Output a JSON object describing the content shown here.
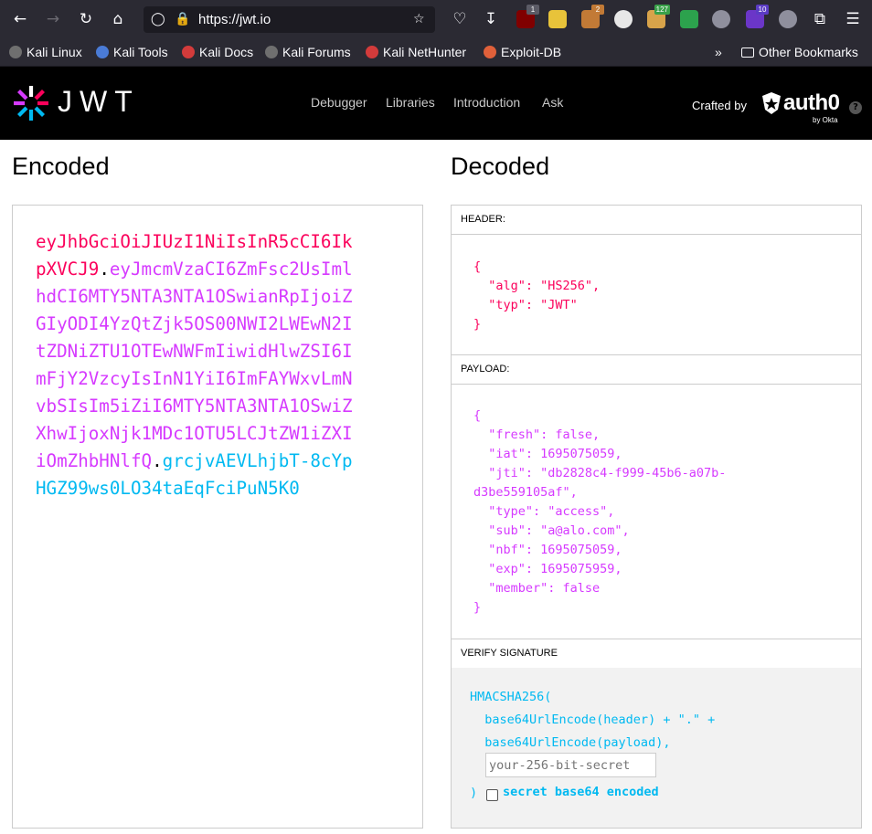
{
  "browser": {
    "url": "https://jwt.io",
    "extensions": [
      {
        "name": "ublock-icon",
        "color": "#800000",
        "badge": "1",
        "badge_color": "#5b5b66"
      },
      {
        "name": "ghost-icon",
        "color": "#e8c33a",
        "badge": "",
        "badge_color": ""
      },
      {
        "name": "fox-icon",
        "color": "#c27a36",
        "badge": "2",
        "badge_color": "#c27a36"
      },
      {
        "name": "c-circle-icon",
        "color": "#e7e7e7",
        "badge": "",
        "badge_color": ""
      },
      {
        "name": "cookie-icon",
        "color": "#d8a34a",
        "badge": "127",
        "badge_color": "#3aa14a"
      },
      {
        "name": "w-shield-icon",
        "color": "#2ca24d",
        "badge": "",
        "badge_color": ""
      },
      {
        "name": "speaker-icon",
        "color": "#8f8f9d",
        "badge": "",
        "badge_color": ""
      },
      {
        "name": "cube-icon",
        "color": "#6b36c8",
        "badge": "10",
        "badge_color": "#5b3cc4"
      },
      {
        "name": "puzzle-figure-icon",
        "color": "#8f8f9d",
        "badge": "",
        "badge_color": ""
      }
    ],
    "bookmarks": [
      {
        "label": "Kali Linux",
        "color": "#6f6f6f"
      },
      {
        "label": "Kali Tools",
        "color": "#4a7bd6"
      },
      {
        "label": "Kali Docs",
        "color": "#d33b3b"
      },
      {
        "label": "Kali Forums",
        "color": "#6f6f6f"
      },
      {
        "label": "Kali NetHunter",
        "color": "#d33b3b"
      },
      {
        "label": "Exploit-DB",
        "color": "#e0603a"
      }
    ],
    "other_bookmarks": "Other Bookmarks"
  },
  "site": {
    "logo_text": "JWT",
    "nav": [
      "Debugger",
      "Libraries",
      "Introduction",
      "Ask"
    ],
    "crafted_by": "Crafted by",
    "auth0": "auth0",
    "by_okta": "by Okta",
    "help": "?"
  },
  "encoded": {
    "title": "Encoded",
    "header": "eyJhbGciOiJIUzI1NiIsInR5cCI6IkpXVCJ9",
    "payload": "eyJmcmVzaCI6ZmFsc2UsImlhdCI6MTY5NTA3NTA1OSwianRpIjoiZGIyODI4YzQtZjk5OS00NWI2LWEwN2ItZDNiZTU1OTEwNWFmIiwidHlwZSI6ImFjY2VzcyIsInN1YiI6ImFAYWxvLmNvbSIsIm5iZiI6MTY5NTA3NTA1OSwiZXhwIjoxNjk1MDc1OTU5LCJtZW1iZXIiOmZhbHNlfQ",
    "signature": "grcjvAEVLhjbT-8cYpHGZ99ws0LO34taEqFciPuN5K0",
    "dot": "."
  },
  "decoded": {
    "title": "Decoded",
    "header_label": "HEADER:",
    "header_code": "{\n  \"alg\": \"HS256\",\n  \"typ\": \"JWT\"\n}",
    "payload_label": "PAYLOAD:",
    "payload_code": "{\n  \"fresh\": false,\n  \"iat\": 1695075059,\n  \"jti\": \"db2828c4-f999-45b6-a07b-\nd3be559105af\",\n  \"type\": \"access\",\n  \"sub\": \"a@alo.com\",\n  \"nbf\": 1695075059,\n  \"exp\": 1695075959,\n  \"member\": false\n}",
    "verify_label": "VERIFY SIGNATURE",
    "verify_code": "HMACSHA256(\n  base64UrlEncode(header) + \".\" +\n  base64UrlEncode(payload),",
    "secret_placeholder": "your-256-bit-secret",
    "close_paren": ")",
    "secret_b64_label": "secret base64 encoded"
  }
}
